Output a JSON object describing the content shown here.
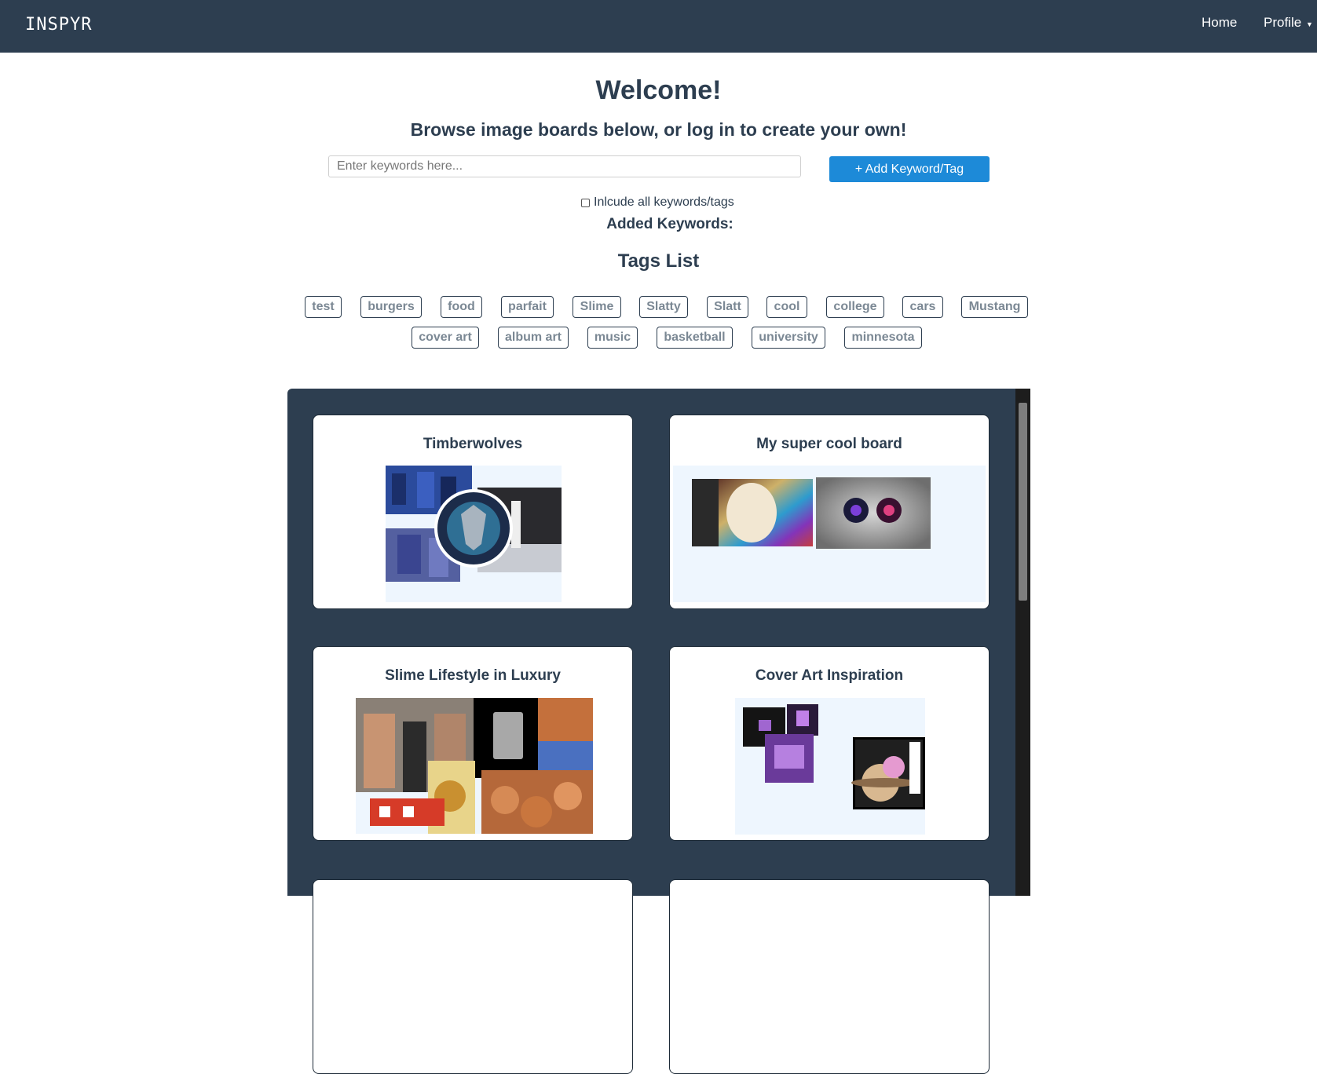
{
  "navbar": {
    "brand": "INSPYR",
    "home": "Home",
    "profile": "Profile"
  },
  "hero": {
    "welcome": "Welcome!",
    "subtitle": "Browse image boards below, or log in to create your own!"
  },
  "search": {
    "placeholder": "Enter keywords here...",
    "add_button": "+ Add Keyword/Tag",
    "include_all_label": "Inlcude all keywords/tags",
    "added_keywords_label": "Added Keywords:"
  },
  "tags": {
    "title": "Tags List",
    "items": [
      "test",
      "burgers",
      "food",
      "parfait",
      "Slime",
      "Slatty",
      "Slatt",
      "cool",
      "college",
      "cars",
      "Mustang",
      "cover art",
      "album art",
      "music",
      "basketball",
      "university",
      "minnesota"
    ]
  },
  "boards": [
    {
      "title": "Timberwolves"
    },
    {
      "title": "My super cool board"
    },
    {
      "title": "Slime Lifestyle in Luxury"
    },
    {
      "title": "Cover Art Inspiration"
    }
  ],
  "icons": {
    "caret": "caret-down-icon",
    "checkbox": "checkbox-unchecked-icon"
  }
}
